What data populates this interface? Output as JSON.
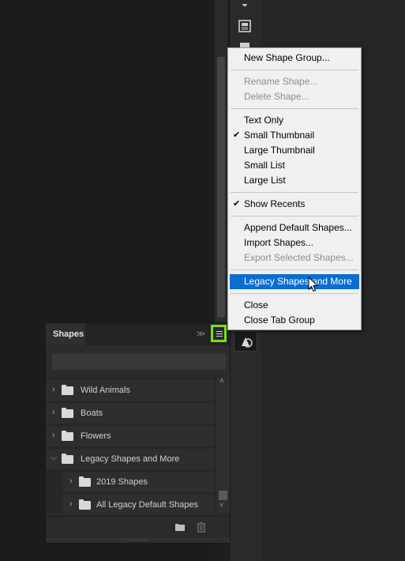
{
  "context_menu": {
    "items": [
      {
        "label": "New Shape Group...",
        "enabled": true,
        "checked": false
      },
      {
        "label": "Rename Shape...",
        "enabled": false,
        "checked": false
      },
      {
        "label": "Delete Shape...",
        "enabled": false,
        "checked": false
      },
      {
        "label": "Text Only",
        "enabled": true,
        "checked": false
      },
      {
        "label": "Small Thumbnail",
        "enabled": true,
        "checked": true
      },
      {
        "label": "Large Thumbnail",
        "enabled": true,
        "checked": false
      },
      {
        "label": "Small List",
        "enabled": true,
        "checked": false
      },
      {
        "label": "Large List",
        "enabled": true,
        "checked": false
      },
      {
        "label": "Show Recents",
        "enabled": true,
        "checked": true
      },
      {
        "label": "Append Default Shapes...",
        "enabled": true,
        "checked": false
      },
      {
        "label": "Import Shapes...",
        "enabled": true,
        "checked": false
      },
      {
        "label": "Export Selected Shapes...",
        "enabled": false,
        "checked": false
      },
      {
        "label": "Legacy Shapes and More",
        "enabled": true,
        "checked": false,
        "highlighted": true
      },
      {
        "label": "Close",
        "enabled": true,
        "checked": false
      },
      {
        "label": "Close Tab Group",
        "enabled": true,
        "checked": false
      }
    ],
    "checkmark": "✔",
    "highlight_color": "#0a6ed1"
  },
  "shapes_panel": {
    "tab_label": "Shapes",
    "collapse_icon": "double-chevron-right-icon",
    "menu_icon": "hamburger-icon",
    "menu_button_highlight_color": "#7ddc1f",
    "search_placeholder": "",
    "groups": [
      {
        "name": "Wild Animals",
        "expanded": false,
        "level": 0
      },
      {
        "name": "Boats",
        "expanded": false,
        "level": 0
      },
      {
        "name": "Flowers",
        "expanded": false,
        "level": 0
      },
      {
        "name": "Legacy Shapes and More",
        "expanded": true,
        "level": 0
      },
      {
        "name": "2019 Shapes",
        "expanded": false,
        "level": 1
      },
      {
        "name": "All Legacy Default Shapes",
        "expanded": false,
        "level": 1
      }
    ],
    "footer_icons": [
      "new-group-folder-icon",
      "trash-icon"
    ]
  },
  "dock_icons": [
    "panel-icon",
    "list-icon",
    "shapes-history-icon"
  ]
}
